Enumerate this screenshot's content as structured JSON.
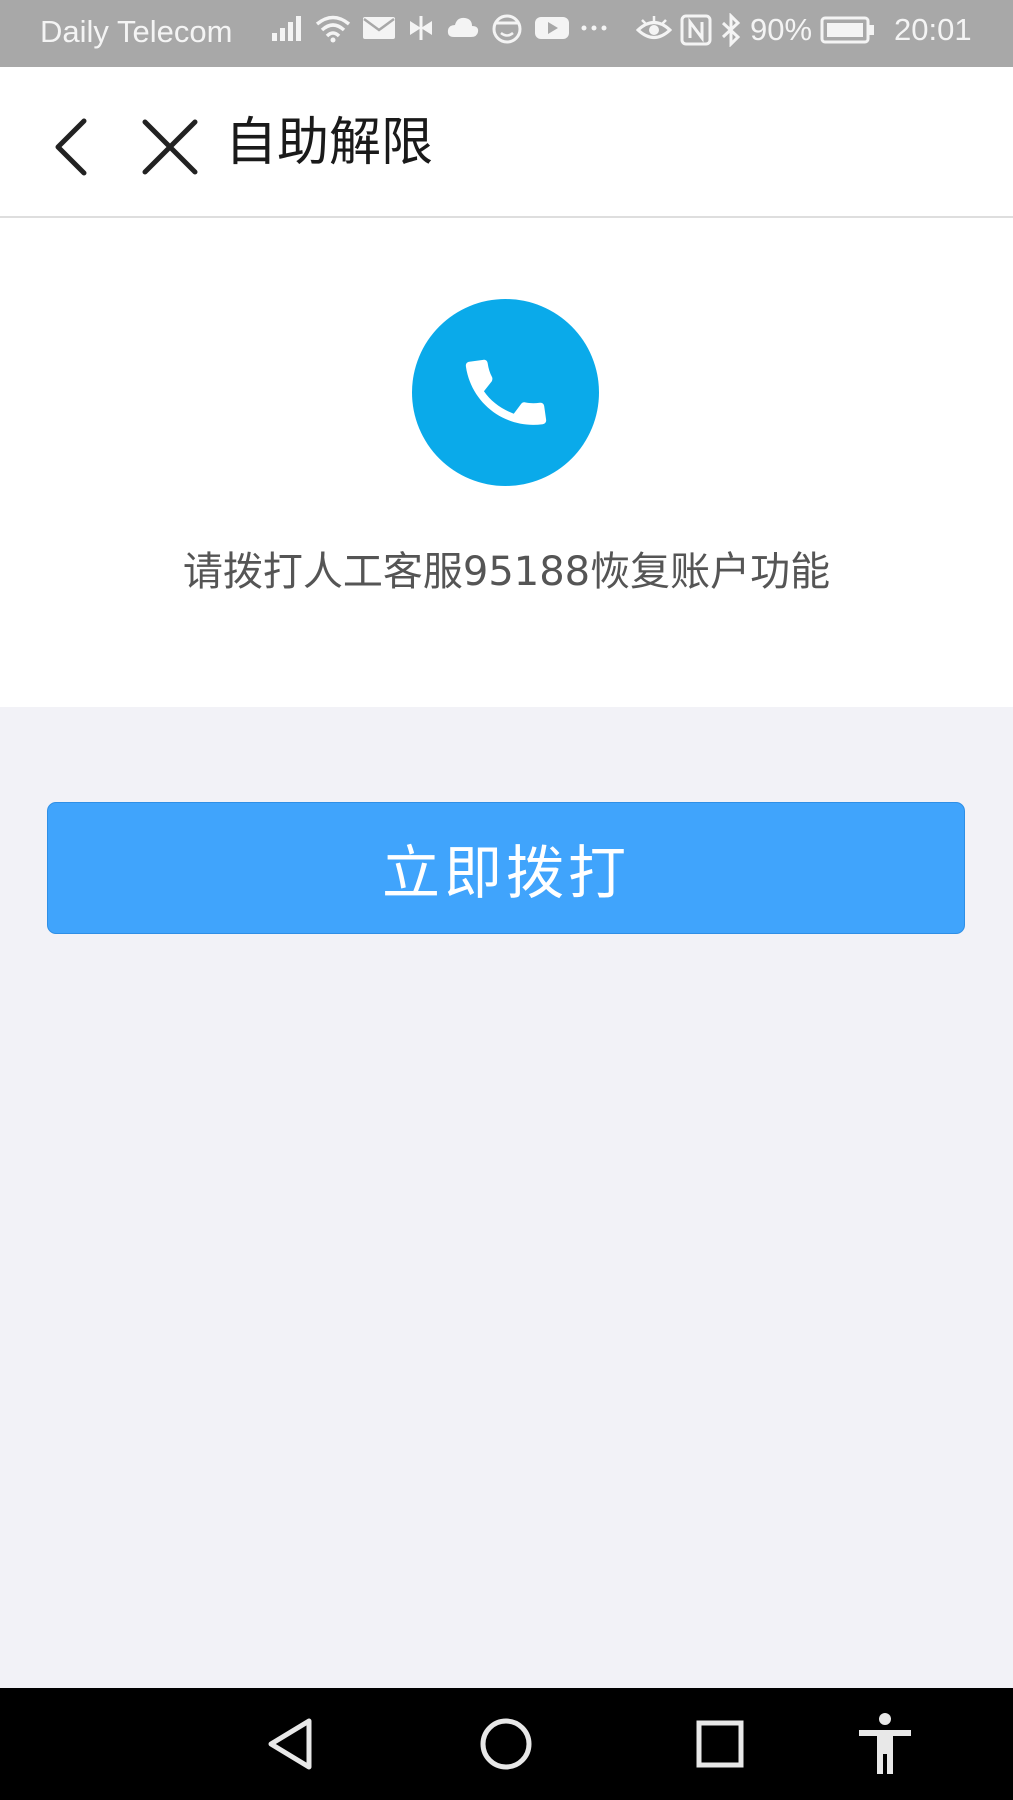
{
  "status_bar": {
    "carrier": "Daily Telecom",
    "battery": "90%",
    "time": "20:01",
    "icons": [
      "signal-icon",
      "wifi-icon",
      "mail-icon",
      "app-icon",
      "cloud-icon",
      "face-icon",
      "youtube-icon",
      "more-icon",
      "eye-icon",
      "nfc-icon",
      "bluetooth-icon",
      "battery-icon"
    ]
  },
  "header": {
    "title": "自助解限",
    "back_icon": "chevron-left-icon",
    "close_icon": "close-icon"
  },
  "main": {
    "phone_icon": "phone-icon",
    "hint": "请拨打人工客服95188恢复账户功能",
    "call_button_label": "立即拨打"
  },
  "nav_bar": {
    "icons": [
      "nav-back-icon",
      "nav-home-icon",
      "nav-recents-icon",
      "accessibility-icon"
    ]
  },
  "colors": {
    "accent_circle": "#0aaaea",
    "button": "#40a4fc",
    "page_background": "#f2f2f7",
    "status_bar": "#a8a8a8"
  }
}
